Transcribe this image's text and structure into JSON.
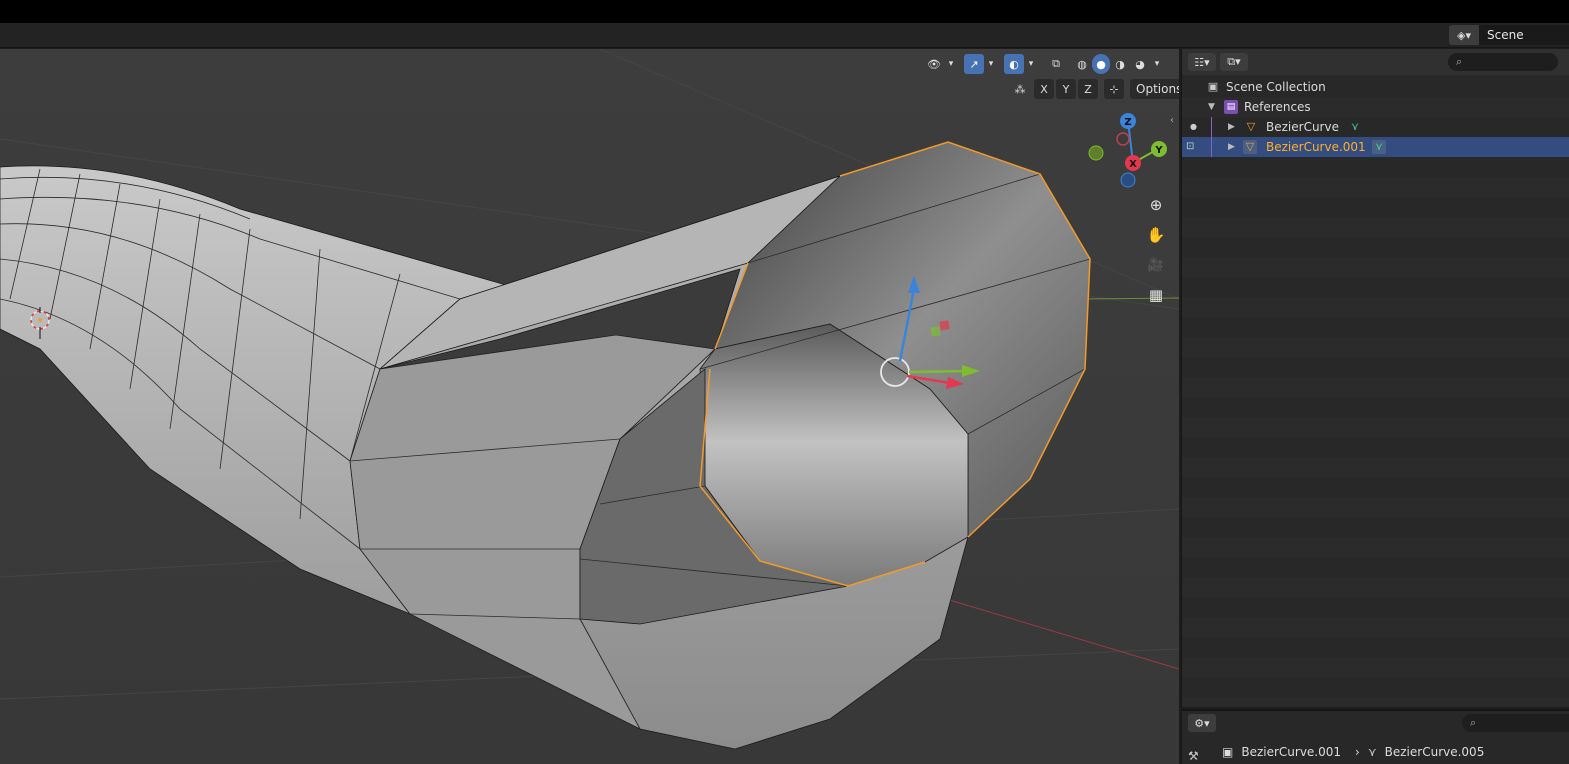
{
  "topbar": {
    "scene_icon": "scene-icon",
    "scene_name": "Scene"
  },
  "viewport": {
    "header_buttons": {
      "visibility_icon": "eye-icon",
      "gizmo_icon": "gizmo-icon",
      "overlay_icon": "overlay-icon",
      "xray_icon": "xray-icon",
      "shading_modes": [
        "wireframe",
        "solid",
        "material",
        "rendered"
      ],
      "active_shading": "solid"
    },
    "mirror_axes": [
      "X",
      "Y",
      "Z"
    ],
    "options_label": "Options",
    "gizmo_axes": {
      "z": "Z",
      "y": "Y",
      "x": "X"
    },
    "nav_tools": [
      "zoom-icon",
      "pan-hand-icon",
      "camera-icon",
      "grid-icon"
    ]
  },
  "outliner": {
    "rows": [
      {
        "label": "Scene Collection",
        "icon": "collection-icon",
        "depth": 0
      },
      {
        "label": "References",
        "icon": "collection-icon",
        "depth": 1,
        "expanded": true
      },
      {
        "label": "BezierCurve",
        "icon": "curve-object-icon",
        "depth": 2,
        "selected": false
      },
      {
        "label": "BezierCurve.001",
        "icon": "curve-object-icon",
        "depth": 2,
        "selected": true
      }
    ]
  },
  "properties": {
    "breadcrumb": [
      "BezierCurve.001",
      "BezierCurve.005"
    ]
  },
  "colors": {
    "selection_outline": "#f29b2a",
    "gizmo_x": "#e5384e",
    "gizmo_y": "#7dbd2f",
    "gizmo_z": "#3a84d9",
    "outliner_selected": "#334d80"
  }
}
